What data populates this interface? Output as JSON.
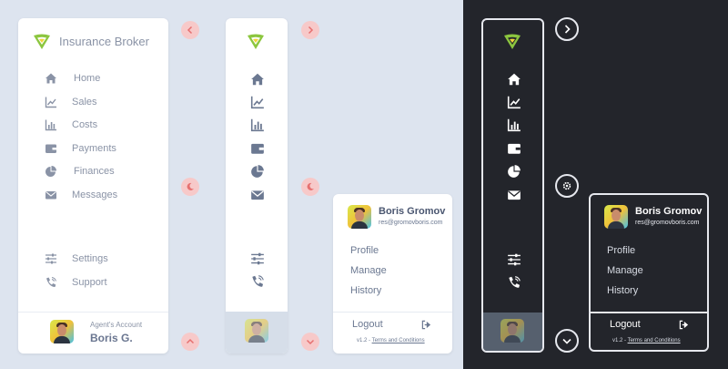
{
  "brand": {
    "name": "Insurance Broker",
    "logo_icon": "shield-logo-icon"
  },
  "nav": {
    "items": [
      {
        "id": "home",
        "label": "Home",
        "icon": "home-icon"
      },
      {
        "id": "sales",
        "label": "Sales",
        "icon": "line-chart-icon"
      },
      {
        "id": "costs",
        "label": "Costs",
        "icon": "bar-chart-icon"
      },
      {
        "id": "payments",
        "label": "Payments",
        "icon": "wallet-icon"
      },
      {
        "id": "finances",
        "label": "Finances",
        "icon": "pie-chart-icon"
      },
      {
        "id": "messages",
        "label": "Messages",
        "icon": "envelope-icon"
      }
    ],
    "bottom": [
      {
        "id": "settings",
        "label": "Settings",
        "icon": "sliders-icon"
      },
      {
        "id": "support",
        "label": "Support",
        "icon": "phone-icon"
      }
    ]
  },
  "account": {
    "caption": "Agent's Account",
    "short_name": "Boris G."
  },
  "profile": {
    "name": "Boris Gromov",
    "email": "res@gromovboris.com",
    "links": [
      "Profile",
      "Manage",
      "History"
    ],
    "logout": "Logout",
    "version": "v1.2 -",
    "terms": "Terms and Conditions"
  },
  "colors": {
    "background_light": "#dde4ef",
    "background_dark": "#23252b",
    "accent_pink": "#f7c9c9",
    "logo_green": "#8cc63f",
    "logo_yellow": "#f2d43b",
    "text_muted": "#8a93a6",
    "text_dark": "#4a5670"
  }
}
